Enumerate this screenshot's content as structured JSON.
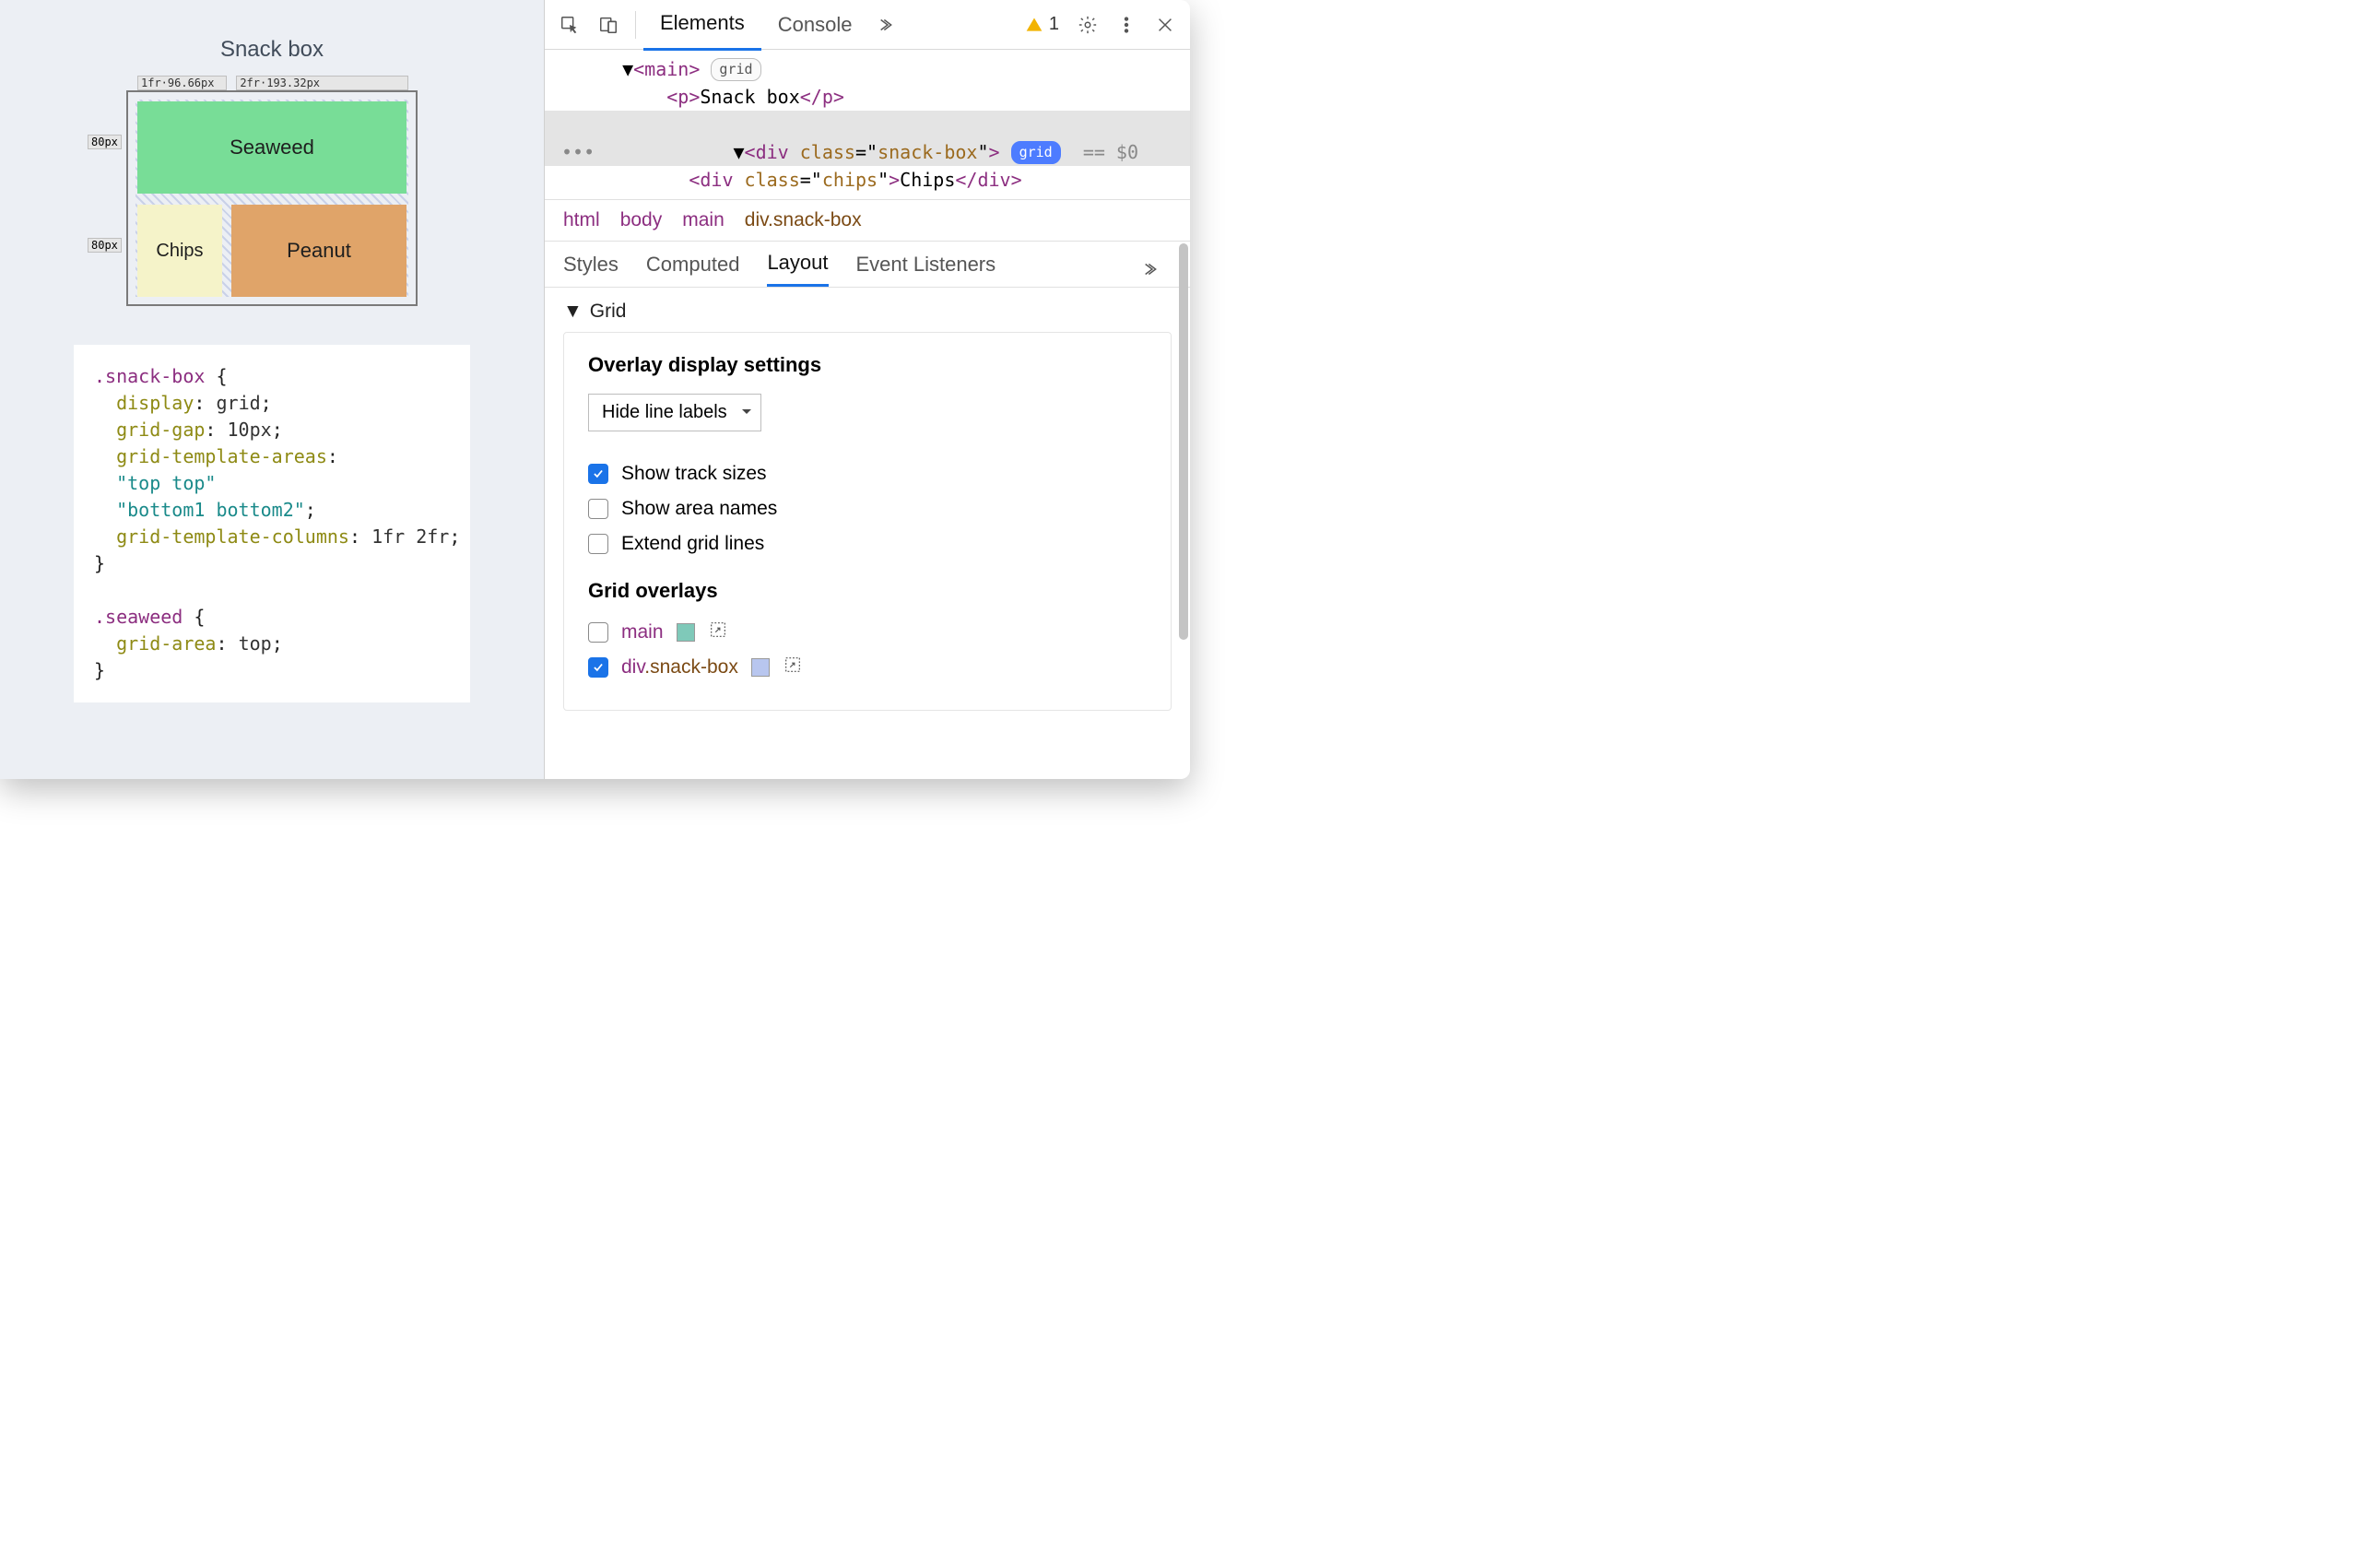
{
  "preview": {
    "title": "Snack box",
    "col_labels": [
      "1fr·96.66px",
      "2fr·193.32px"
    ],
    "row_labels": [
      "80px",
      "80px"
    ],
    "cells": {
      "seaweed": "Seaweed",
      "chips": "Chips",
      "peanut": "Peanut"
    },
    "css_selector1": ".snack-box",
    "css_props1": {
      "display": "grid",
      "grid-gap": "10px",
      "grid-template-areas": [
        "\"top top\"",
        "\"bottom1 bottom2\""
      ],
      "grid-template-columns": "1fr 2fr"
    },
    "css_selector2": ".seaweed",
    "css_props2": {
      "grid-area": "top"
    }
  },
  "toolbar": {
    "tabs": {
      "elements": "Elements",
      "console": "Console"
    },
    "warnings": "1"
  },
  "dom": {
    "main_open": "<main>",
    "main_badge": "grid",
    "p_line": "<p>Snack box</p>",
    "div_open": "<div class=\"snack-box\">",
    "div_badge": "grid",
    "equals": "== $0",
    "chips_line": "<div class=\"chips\">Chips</div>"
  },
  "breadcrumb": [
    "html",
    "body",
    "main",
    "div.snack-box"
  ],
  "subtabs": [
    "Styles",
    "Computed",
    "Layout",
    "Event Listeners"
  ],
  "layout": {
    "section": "Grid",
    "overlay_settings_title": "Overlay display settings",
    "line_labels_select": "Hide line labels",
    "chk_track_sizes": "Show track sizes",
    "chk_area_names": "Show area names",
    "chk_extend_lines": "Extend grid lines",
    "grid_overlays_title": "Grid overlays",
    "overlays": [
      {
        "name": "main",
        "cls": "",
        "color": "#7fc9b9",
        "checked": false
      },
      {
        "name": "div",
        "cls": ".snack-box",
        "color": "#b8c6ef",
        "checked": true
      }
    ]
  }
}
